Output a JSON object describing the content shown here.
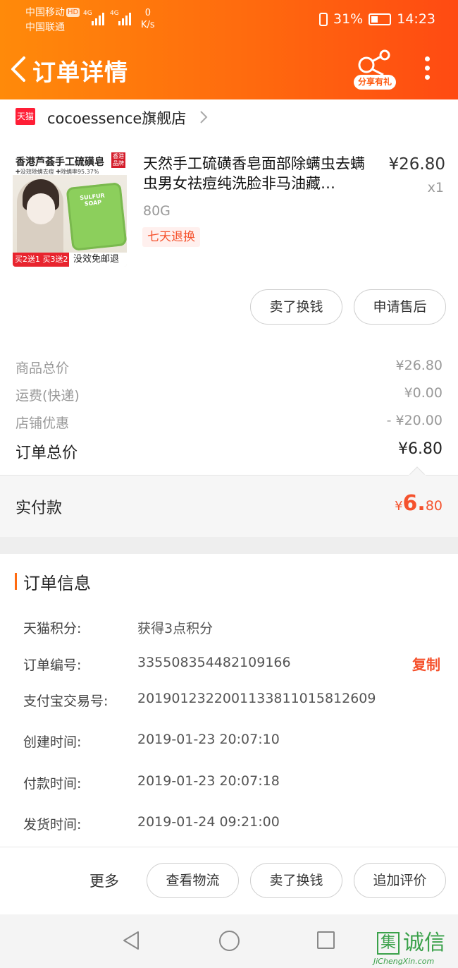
{
  "status_bar": {
    "carrier1": "中国移动",
    "hd": "HD",
    "carrier2": "中国联通",
    "sig1": "4G",
    "sig2": "4G",
    "speed_val": "0",
    "speed_unit": "K/s",
    "battery": "31%",
    "time": "14:23"
  },
  "header": {
    "title": "订单详情",
    "share_label": "分享有礼"
  },
  "shop": {
    "badge": "天猫",
    "name": "cocoessence旗舰店"
  },
  "product": {
    "thumb": {
      "top": "香港芦荟手工硫磺皂",
      "sub": "✚没效除螨去痘 ✚除螨率95.37%",
      "corner": "香港品牌",
      "promo": "买2送1 买3送2",
      "free": "没效免邮退"
    },
    "title": "天然手工硫磺香皂面部除螨虫去螨虫男女祛痘纯洗脸非马油藏…",
    "price": "¥26.80",
    "qty": "x1",
    "spec": "80G",
    "tag": "七天退换"
  },
  "product_actions": {
    "sell": "卖了换钱",
    "after_sale": "申请售后"
  },
  "summary": {
    "goods_label": "商品总价",
    "goods_value": "¥26.80",
    "ship_label": "运费(快递)",
    "ship_value": "¥0.00",
    "discount_label": "店铺优惠",
    "discount_value": "- ¥20.00",
    "total_label": "订单总价",
    "total_value": "¥6.80"
  },
  "paid": {
    "label": "实付款",
    "currency": "¥",
    "integer": "6.",
    "decimal": "80"
  },
  "order_info": {
    "title": "订单信息",
    "copy_label": "复制",
    "rows": [
      {
        "key": "天猫积分:",
        "value": "获得3点积分"
      },
      {
        "key": "订单编号:",
        "value": "335508354482109166"
      },
      {
        "key": "支付宝交易号:",
        "value": "2019012322001133811015812609"
      },
      {
        "key": "创建时间:",
        "value": "2019-01-23 20:07:10"
      },
      {
        "key": "付款时间:",
        "value": "2019-01-23 20:07:18"
      },
      {
        "key": "发货时间:",
        "value": "2019-01-24 09:21:00"
      }
    ]
  },
  "footer": {
    "more": "更多",
    "logistics": "查看物流",
    "sell": "卖了换钱",
    "review": "追加评价"
  },
  "watermark": {
    "box": "集",
    "text": "诚信",
    "url": "JiChengXin.com"
  },
  "colors": {
    "header_from": "#ff8a0a",
    "header_to": "#ff4a12",
    "accent": "#f5522d"
  }
}
